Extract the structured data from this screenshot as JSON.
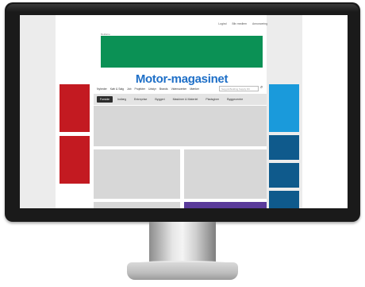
{
  "topbar": {
    "links": [
      "Logind",
      "Bliv medlem",
      "Annoncering"
    ]
  },
  "ad": {
    "label": "Reklame",
    "color": "#0b9155"
  },
  "logo": {
    "text": "Motor-magasinet"
  },
  "nav": {
    "items": [
      "Nyheder",
      "Køb & Salg",
      "Job",
      "Projekter",
      "Udstyr",
      "Brands",
      "Videnscenter",
      "Mærker"
    ]
  },
  "search": {
    "placeholder": "Søg på Building Supply DK"
  },
  "tabs": {
    "items": [
      "Forside",
      "Indlæg",
      "Entreprise",
      "Byggeri",
      "Maskiner & Materiel",
      "Pladsgiver",
      "Byggecentre"
    ]
  },
  "ads_left_color": "#c31a21",
  "ads_right": {
    "top": "#1a9adb",
    "others": "#0f5a8c"
  },
  "teaser_purple": "#5a3b9a"
}
